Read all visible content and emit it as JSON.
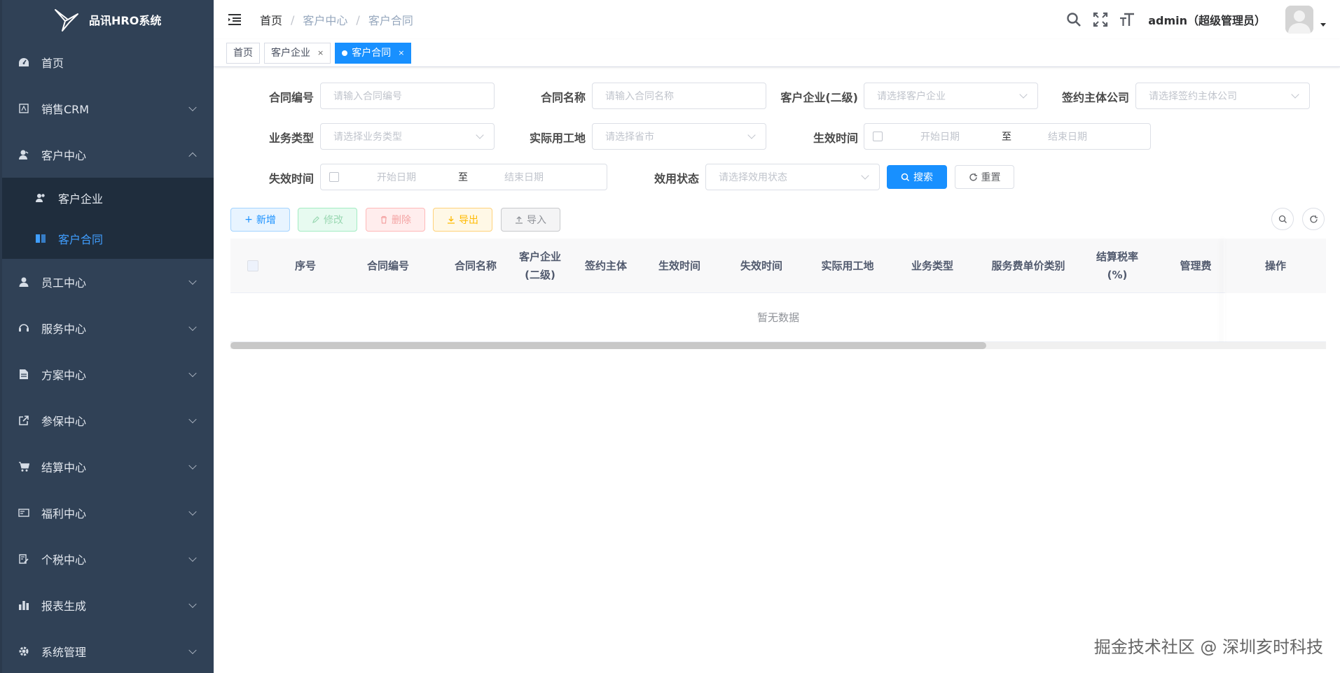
{
  "app": {
    "title": "品讯HRO系统"
  },
  "sidebar": {
    "items": [
      {
        "label": "首页",
        "icon": "dashboard-icon"
      },
      {
        "label": "销售CRM",
        "icon": "crm-icon"
      },
      {
        "label": "客户中心",
        "icon": "customer-icon",
        "expanded": true,
        "children": [
          {
            "label": "客户企业",
            "icon": "people-icon"
          },
          {
            "label": "客户合同",
            "icon": "book-icon",
            "active": true
          }
        ]
      },
      {
        "label": "员工中心",
        "icon": "user-icon"
      },
      {
        "label": "服务中心",
        "icon": "service-icon"
      },
      {
        "label": "方案中心",
        "icon": "document-icon"
      },
      {
        "label": "参保中心",
        "icon": "external-link-icon"
      },
      {
        "label": "结算中心",
        "icon": "cart-icon"
      },
      {
        "label": "福利中心",
        "icon": "card-icon"
      },
      {
        "label": "个税中心",
        "icon": "tax-icon"
      },
      {
        "label": "报表生成",
        "icon": "bar-chart-icon"
      },
      {
        "label": "系统管理",
        "icon": "gear-icon"
      }
    ]
  },
  "header": {
    "breadcrumb": [
      "首页",
      "客户中心",
      "客户合同"
    ],
    "breadcrumb_sep": "/",
    "user": "admin（超级管理员）"
  },
  "tags": [
    {
      "label": "首页"
    },
    {
      "label": "客户企业",
      "close": "×"
    },
    {
      "label": "客户合同",
      "close": "×",
      "active": true
    }
  ],
  "form": {
    "contract_no": {
      "label": "合同编号",
      "placeholder": "请输入合同编号"
    },
    "contract_name": {
      "label": "合同名称",
      "placeholder": "请输入合同名称"
    },
    "customer": {
      "label": "客户企业(二级)",
      "placeholder": "请选择客户企业"
    },
    "signing_company": {
      "label": "签约主体公司",
      "placeholder": "请选择签约主体公司"
    },
    "business_type": {
      "label": "业务类型",
      "placeholder": "请选择业务类型"
    },
    "work_location": {
      "label": "实际用工地",
      "placeholder": "请选择省市"
    },
    "effective_time": {
      "label": "生效时间",
      "start": "开始日期",
      "sep": "至",
      "end": "结束日期"
    },
    "expiry_time": {
      "label": "失效时间",
      "start": "开始日期",
      "sep": "至",
      "end": "结束日期"
    },
    "status": {
      "label": "效用状态",
      "placeholder": "请选择效用状态"
    },
    "search_button": "搜索",
    "reset_button": "重置"
  },
  "toolbar": {
    "add": "新增",
    "edit": "修改",
    "delete": "删除",
    "export": "导出",
    "import": "导入"
  },
  "table": {
    "columns": [
      "序号",
      "合同编号",
      "合同名称",
      "客户企业\n(二级)",
      "签约主体",
      "生效时间",
      "失效时间",
      "实际用工地",
      "业务类型",
      "服务费单价类别",
      "结算税率\n(%)",
      "管理费",
      "操作"
    ],
    "empty_text": "暂无数据",
    "scroll_fraction": 0.69
  },
  "watermark": "掘金技术社区 @ 深圳亥时科技",
  "colors": {
    "sidebar_bg": "#304156",
    "primary": "#1890ff",
    "active_menu": "#409eff"
  }
}
